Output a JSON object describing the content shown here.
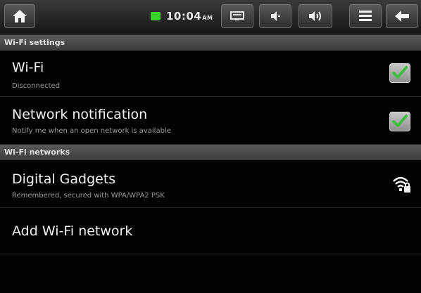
{
  "status_bar": {
    "time": "10:04",
    "ampm": "AM",
    "icons": [
      "home-icon",
      "battery-icon",
      "screenshot-icon",
      "volume-down-icon",
      "volume-up-icon",
      "menu-icon",
      "back-icon"
    ]
  },
  "sections": {
    "wifi_settings": {
      "label": "Wi-Fi settings"
    },
    "wifi_networks": {
      "label": "Wi-Fi networks"
    }
  },
  "settings": {
    "wifi": {
      "title": "Wi-Fi",
      "summary": "Disconnected",
      "checked": true
    },
    "notification": {
      "title": "Network notification",
      "summary": "Notify me when an open network is available",
      "checked": true
    }
  },
  "networks": [
    {
      "name": "Digital Gadgets",
      "summary": "Remembered, secured with WPA/WPA2 PSK",
      "icon": "wifi-lock-icon"
    }
  ],
  "add_network": {
    "label": "Add Wi-Fi network"
  },
  "colors": {
    "check_green": "#3fbf3f",
    "battery_green": "#3bd12c"
  }
}
